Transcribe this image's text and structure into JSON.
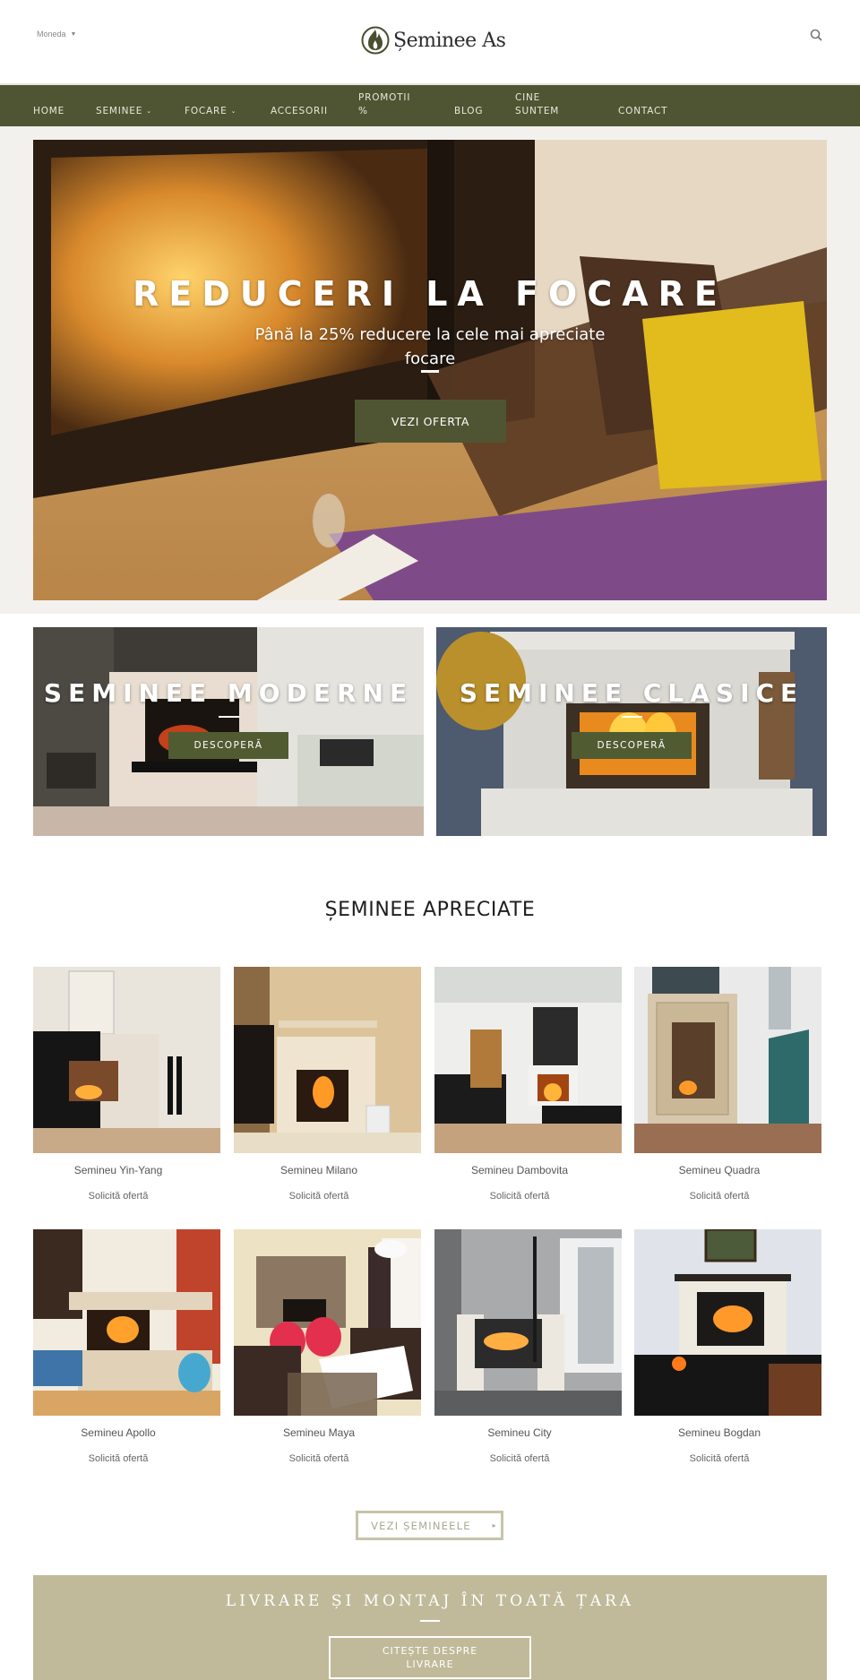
{
  "header": {
    "currency_label": "Moneda",
    "logo_text": "Șeminee As",
    "search_icon": "search-icon"
  },
  "nav": {
    "items": [
      {
        "label": "HOME",
        "has_dropdown": false
      },
      {
        "label": "SEMINEE",
        "has_dropdown": true
      },
      {
        "label": "FOCARE",
        "has_dropdown": true
      },
      {
        "label": "ACCESORII",
        "has_dropdown": false
      },
      {
        "label": "PROMOTII %",
        "has_dropdown": false
      },
      {
        "label": "BLOG",
        "has_dropdown": false
      },
      {
        "label": "CINE SUNTEM",
        "has_dropdown": false
      },
      {
        "label": "CONTACT",
        "has_dropdown": false
      }
    ],
    "dropdown_glyph": "⌄"
  },
  "hero": {
    "title": "REDUCERI LA FOCARE",
    "subtitle": "Până la 25% reducere la cele mai apreciate focare",
    "button_label": "VEZI OFERTA"
  },
  "categories": [
    {
      "title": "SEMINEE MODERNE",
      "button_label": "DESCOPERĂ"
    },
    {
      "title": "SEMINEE CLASICE",
      "button_label": "DESCOPERĂ"
    }
  ],
  "featured": {
    "title": "ȘEMINEE APRECIATE",
    "products": [
      {
        "name": "Semineu Yin-Yang",
        "cta": "Solicită ofertă"
      },
      {
        "name": "Semineu Milano",
        "cta": "Solicită ofertă"
      },
      {
        "name": "Semineu Dambovita",
        "cta": "Solicită ofertă"
      },
      {
        "name": "Semineu Quadra",
        "cta": "Solicită ofertă"
      },
      {
        "name": "Semineu Apollo",
        "cta": "Solicită ofertă"
      },
      {
        "name": "Semineu Maya",
        "cta": "Solicită ofertă"
      },
      {
        "name": "Semineu City",
        "cta": "Solicită ofertă"
      },
      {
        "name": "Semineu Bogdan",
        "cta": "Solicită ofertă"
      }
    ],
    "view_all_label": "VEZI ȘEMINEELE",
    "view_all_arrow": "▸"
  },
  "delivery": {
    "title": "LIVRARE ȘI MONTAJ ÎN TOATĂ ȚARA",
    "button_label": "CITEȘTE DESPRE LIVRARE"
  },
  "colors": {
    "brand_green": "#4f5532",
    "button_green": "#505b32",
    "delivery_beige": "#c0ba9a",
    "hero_bg": "#f2f1ee"
  }
}
